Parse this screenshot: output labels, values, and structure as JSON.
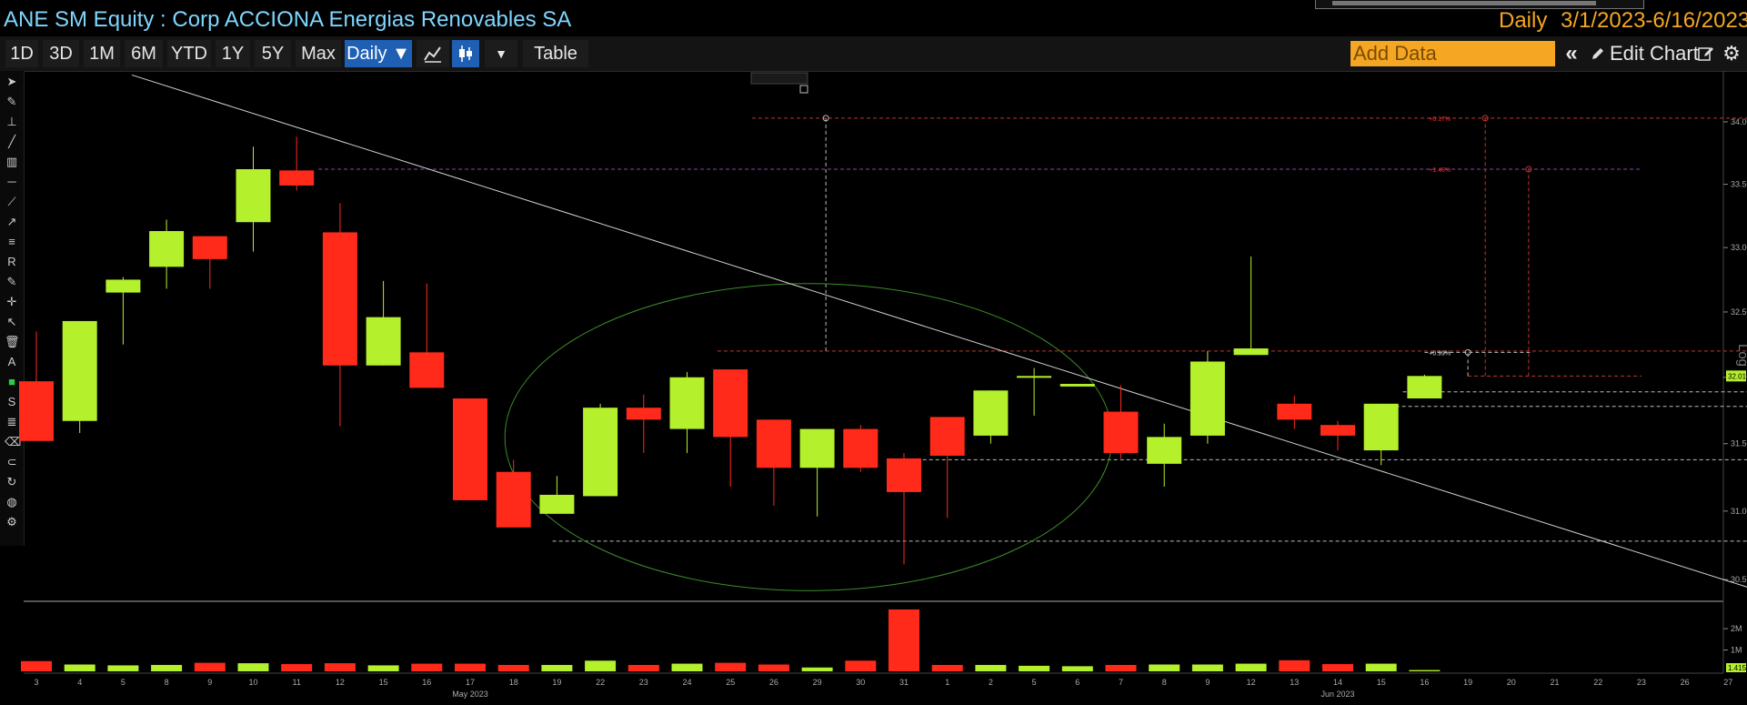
{
  "header": {
    "security_title": "ANE SM Equity : Corp ACCIONA Energias Renovables SA",
    "frequency": "Daily",
    "date_range": "3/1/2023-6/16/2023"
  },
  "toolbar": {
    "periods": [
      "1D",
      "3D",
      "1M",
      "6M",
      "YTD",
      "1Y",
      "5Y",
      "Max"
    ],
    "frequency_menu": "Daily ▼",
    "table_label": "Table",
    "add_data_placeholder": "Add Data",
    "edit_chart_label": "Edit Chart",
    "icons": [
      "line-chart-icon",
      "candlestick-icon",
      "dropdown-icon",
      "collapse-icon",
      "pencil-icon",
      "edit-icon",
      "gear-icon"
    ]
  },
  "left_tools": {
    "icons": [
      "cursor-icon",
      "pen-icon",
      "ruler-icon",
      "line-icon",
      "channel-icon",
      "hline-icon",
      "brush-icon",
      "arrow-icon",
      "fib-icon",
      "r-icon",
      "pencil-icon",
      "crosshair-icon",
      "pointer-icon",
      "trash-icon",
      "text-icon",
      "color-icon",
      "style-icon",
      "lines-icon",
      "eraser-icon",
      "magnet-icon",
      "refresh-icon",
      "palette-icon",
      "gear-icon"
    ]
  },
  "chart_data": {
    "type": "candlestick",
    "scale": "log",
    "scale_label": "Log",
    "x_labels": [
      "3",
      "4",
      "5",
      "8",
      "9",
      "10",
      "11",
      "12",
      "15",
      "16",
      "17",
      "18",
      "19",
      "22",
      "23",
      "24",
      "25",
      "26",
      "29",
      "30",
      "31",
      "1",
      "2",
      "5",
      "6",
      "7",
      "8",
      "9",
      "12",
      "13",
      "14",
      "15",
      "16",
      "19",
      "20",
      "21",
      "22",
      "23",
      "26",
      "27"
    ],
    "month_labels": [
      {
        "label": "May 2023",
        "at_index": 10
      },
      {
        "label": "Jun 2023",
        "at_index": 30
      }
    ],
    "candles": [
      {
        "o": 31.97,
        "h": 32.35,
        "l": 31.57,
        "c": 31.52
      },
      {
        "o": 31.67,
        "h": 32.43,
        "l": 31.58,
        "c": 32.43
      },
      {
        "o": 32.65,
        "h": 32.77,
        "l": 32.25,
        "c": 32.75
      },
      {
        "o": 32.85,
        "h": 33.22,
        "l": 32.68,
        "c": 33.13
      },
      {
        "o": 33.09,
        "h": 33.09,
        "l": 32.68,
        "c": 32.91
      },
      {
        "o": 33.2,
        "h": 33.8,
        "l": 32.97,
        "c": 33.62
      },
      {
        "o": 33.61,
        "h": 33.88,
        "l": 33.45,
        "c": 33.49
      },
      {
        "o": 33.12,
        "h": 33.35,
        "l": 31.63,
        "c": 32.09
      },
      {
        "o": 32.09,
        "h": 32.74,
        "l": 32.09,
        "c": 32.46
      },
      {
        "o": 32.19,
        "h": 32.72,
        "l": 32.02,
        "c": 31.92
      },
      {
        "o": 31.84,
        "h": 31.84,
        "l": 31.08,
        "c": 31.08
      },
      {
        "o": 31.29,
        "h": 31.38,
        "l": 30.93,
        "c": 30.88
      },
      {
        "o": 30.98,
        "h": 31.26,
        "l": 31.02,
        "c": 31.12
      },
      {
        "o": 31.11,
        "h": 31.8,
        "l": 31.13,
        "c": 31.77
      },
      {
        "o": 31.77,
        "h": 31.87,
        "l": 31.43,
        "c": 31.68
      },
      {
        "o": 31.61,
        "h": 32.04,
        "l": 31.43,
        "c": 32.0
      },
      {
        "o": 32.06,
        "h": 32.06,
        "l": 31.18,
        "c": 31.55
      },
      {
        "o": 31.68,
        "h": 31.68,
        "l": 31.04,
        "c": 31.32
      },
      {
        "o": 31.32,
        "h": 31.61,
        "l": 30.96,
        "c": 31.61
      },
      {
        "o": 31.61,
        "h": 31.64,
        "l": 31.29,
        "c": 31.32
      },
      {
        "o": 31.39,
        "h": 31.43,
        "l": 30.61,
        "c": 31.14
      },
      {
        "o": 31.7,
        "h": 31.7,
        "l": 30.95,
        "c": 31.41
      },
      {
        "o": 31.56,
        "h": 31.9,
        "l": 31.5,
        "c": 31.9
      },
      {
        "o": 32.0,
        "h": 32.07,
        "l": 31.71,
        "c": 32.01
      },
      {
        "o": 31.93,
        "h": 31.93,
        "l": 31.93,
        "c": 31.95
      },
      {
        "o": 31.74,
        "h": 31.94,
        "l": 31.39,
        "c": 31.43
      },
      {
        "o": 31.35,
        "h": 31.65,
        "l": 31.18,
        "c": 31.55
      },
      {
        "o": 31.56,
        "h": 32.2,
        "l": 31.5,
        "c": 32.12
      },
      {
        "o": 32.17,
        "h": 32.93,
        "l": 32.18,
        "c": 32.22
      },
      {
        "o": 31.8,
        "h": 31.86,
        "l": 31.61,
        "c": 31.68
      },
      {
        "o": 31.64,
        "h": 31.67,
        "l": 31.45,
        "c": 31.56
      },
      {
        "o": 31.45,
        "h": 31.8,
        "l": 31.34,
        "c": 31.8
      },
      {
        "o": 31.84,
        "h": 32.02,
        "l": 31.84,
        "c": 32.01
      }
    ],
    "volume": {
      "unit": "M",
      "values": [
        0.48,
        0.32,
        0.28,
        0.3,
        0.4,
        0.38,
        0.34,
        0.38,
        0.28,
        0.36,
        0.36,
        0.3,
        0.3,
        0.5,
        0.3,
        0.36,
        0.4,
        0.32,
        0.18,
        0.5,
        2.9,
        0.3,
        0.3,
        0.26,
        0.24,
        0.3,
        0.32,
        0.32,
        0.36,
        0.52,
        0.34,
        0.36,
        0.06
      ],
      "y_ticks": [
        {
          "value": 1,
          "label": "1M"
        },
        {
          "value": 2,
          "label": "2M"
        }
      ],
      "last_label": "1.415"
    },
    "y_ticks": [
      {
        "value": 30.5,
        "label": "30.50"
      },
      {
        "value": 31.0,
        "label": "31.00"
      },
      {
        "value": 31.5,
        "label": "31.50"
      },
      {
        "value": 32.0,
        "label": "32.00"
      },
      {
        "value": 32.5,
        "label": "32.50"
      },
      {
        "value": 33.0,
        "label": "33.00"
      },
      {
        "value": 33.5,
        "label": "33.50"
      },
      {
        "value": 34.0,
        "label": "34.00"
      }
    ],
    "last_price_label": "32.01",
    "drawings": {
      "trendline": {
        "from": [
          2.2,
          34.38
        ],
        "to": [
          39.9,
          30.4
        ]
      },
      "hlines": [
        {
          "y": 34.03,
          "from": 16.5,
          "to": 39.5,
          "color": "#c0392b",
          "style": "dashed"
        },
        {
          "y": 33.62,
          "from": 6.5,
          "to": 37.0,
          "color": "#8e44ad",
          "style": "dashed"
        },
        {
          "y": 32.2,
          "from": 15.7,
          "to": 39.5,
          "color": "#c0392b",
          "style": "dashed"
        },
        {
          "y": 32.01,
          "from": 33.0,
          "to": 37.0,
          "color": "#c0392b",
          "style": "dashed"
        },
        {
          "y": 31.78,
          "from": 30.6,
          "to": 39.5,
          "color": "#bbbbbb",
          "style": "dashed"
        },
        {
          "y": 31.38,
          "from": 19.7,
          "to": 39.5,
          "color": "#bbbbbb",
          "style": "dashed"
        },
        {
          "y": 30.78,
          "from": 11.9,
          "to": 39.5,
          "color": "#bbbbbb",
          "style": "dashed"
        },
        {
          "y": 32.19,
          "from": 32.0,
          "to": 34.5,
          "color": "#bbbbbb",
          "style": "dashed"
        },
        {
          "y": 31.89,
          "from": 31.5,
          "to": 39.5,
          "color": "#bbbbbb",
          "style": "dashed"
        }
      ],
      "vlines": [
        {
          "x": 18.2,
          "y1": 32.2,
          "y2": 34.03,
          "color": "#bbbbbb"
        },
        {
          "x": 33.4,
          "y1": 32.01,
          "y2": 34.03,
          "color": "#c0392b"
        },
        {
          "x": 34.4,
          "y1": 32.01,
          "y2": 33.62,
          "color": "#c0392b"
        },
        {
          "x": 33.0,
          "y1": 32.01,
          "y2": 32.19,
          "color": "#bbbbbb"
        }
      ],
      "ellipse": {
        "cx": 17.8,
        "cy": 31.35,
        "rx": 7.0,
        "ry_top": 32.72,
        "ry_bottom": 30.42,
        "color": "#3b8c2a"
      },
      "labels": [
        {
          "text": "+0.17%",
          "x": 32.1,
          "y": 34.03,
          "color": "#e33"
        },
        {
          "text": "+1.48%",
          "x": 32.1,
          "y": 33.62,
          "color": "#e33"
        },
        {
          "text": "+0.99%",
          "x": 32.1,
          "y": 32.19,
          "color": "#ddd"
        }
      ]
    },
    "colors": {
      "up": "#b5f02c",
      "down": "#ff2a1a",
      "background": "#000000"
    }
  }
}
